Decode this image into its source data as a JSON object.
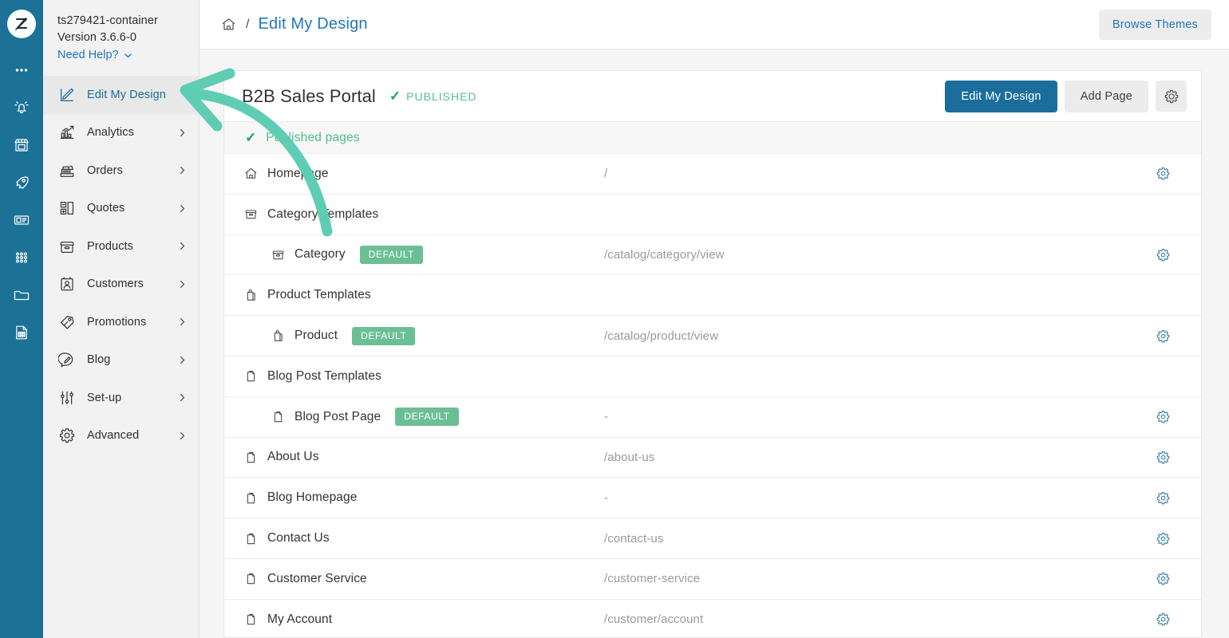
{
  "colors": {
    "rail_blue": "#1b7196",
    "accent_blue": "#2277b8",
    "primary_button": "#1b6e9c",
    "badge_green": "#6cbf94",
    "published_green": "#55bd8e",
    "check_green": "#1aa260",
    "annotation_arrow": "#5fcdb4",
    "panel_grey": "#f2f2f2"
  },
  "rail": {
    "logo_name": "zoey-logo-icon",
    "items": [
      {
        "name": "more-icon",
        "label": "More"
      },
      {
        "name": "notifications-bell-icon",
        "label": "Notifications"
      },
      {
        "name": "storefront-icon",
        "label": "Storefront"
      },
      {
        "name": "rocket-icon",
        "label": "Launch"
      },
      {
        "name": "news-card-icon",
        "label": "News"
      },
      {
        "name": "apps-grid-icon",
        "label": "Apps"
      },
      {
        "name": "folder-icon",
        "label": "Files"
      },
      {
        "name": "report-document-icon",
        "label": "Reports"
      }
    ]
  },
  "sidebar": {
    "store_name": "ts279421-container",
    "version": "Version 3.6.6-0",
    "need_help": "Need Help?",
    "items": [
      {
        "label": "Edit My Design",
        "icon": "design-pen-icon",
        "active": true,
        "chevron": false
      },
      {
        "label": "Analytics",
        "icon": "analytics-chart-icon",
        "active": false,
        "chevron": true
      },
      {
        "label": "Orders",
        "icon": "orders-register-icon",
        "active": false,
        "chevron": true
      },
      {
        "label": "Quotes",
        "icon": "quotes-blocks-icon",
        "active": false,
        "chevron": true
      },
      {
        "label": "Products",
        "icon": "products-box-icon",
        "active": false,
        "chevron": true
      },
      {
        "label": "Customers",
        "icon": "customers-badge-icon",
        "active": false,
        "chevron": true
      },
      {
        "label": "Promotions",
        "icon": "promotions-tag-icon",
        "active": false,
        "chevron": true
      },
      {
        "label": "Blog",
        "icon": "blog-comment-icon",
        "active": false,
        "chevron": true
      },
      {
        "label": "Set-up",
        "icon": "setup-sliders-icon",
        "active": false,
        "chevron": true
      },
      {
        "label": "Advanced",
        "icon": "advanced-gear-icon",
        "active": false,
        "chevron": true
      }
    ]
  },
  "topbar": {
    "home_icon": "home-icon",
    "separator": "/",
    "current": "Edit My Design",
    "browse_themes_label": "Browse Themes"
  },
  "card": {
    "title": "B2B Sales Portal",
    "status_check": "✓",
    "status_label": "PUBLISHED",
    "edit_design_label": "Edit My Design",
    "add_page_label": "Add Page",
    "settings_icon": "gear-icon"
  },
  "table": {
    "section_check": "✓",
    "section_label": "Published pages",
    "rows": [
      {
        "label": "Homepage",
        "icon": "home-icon",
        "indent": false,
        "badge": null,
        "url": "/",
        "gear": true
      },
      {
        "label": "Category Templates",
        "icon": "category-icon",
        "indent": false,
        "badge": null,
        "url": "",
        "gear": false
      },
      {
        "label": "Category",
        "icon": "category-icon",
        "indent": true,
        "badge": "DEFAULT",
        "url": "/catalog/category/view",
        "gear": true
      },
      {
        "label": "Product Templates",
        "icon": "product-icon",
        "indent": false,
        "badge": null,
        "url": "",
        "gear": false
      },
      {
        "label": "Product",
        "icon": "product-icon",
        "indent": true,
        "badge": "DEFAULT",
        "url": "/catalog/product/view",
        "gear": true
      },
      {
        "label": "Blog Post Templates",
        "icon": "page-icon",
        "indent": false,
        "badge": null,
        "url": "",
        "gear": false
      },
      {
        "label": "Blog Post Page",
        "icon": "page-icon",
        "indent": true,
        "badge": "DEFAULT",
        "url": "-",
        "gear": true
      },
      {
        "label": "About Us",
        "icon": "page-icon",
        "indent": false,
        "badge": null,
        "url": "/about-us",
        "gear": true
      },
      {
        "label": "Blog Homepage",
        "icon": "page-icon",
        "indent": false,
        "badge": null,
        "url": "-",
        "gear": true
      },
      {
        "label": "Contact Us",
        "icon": "page-icon",
        "indent": false,
        "badge": null,
        "url": "/contact-us",
        "gear": true
      },
      {
        "label": "Customer Service",
        "icon": "page-icon",
        "indent": false,
        "badge": null,
        "url": "/customer-service",
        "gear": true
      },
      {
        "label": "My Account",
        "icon": "page-icon",
        "indent": false,
        "badge": null,
        "url": "/customer/account",
        "gear": true
      }
    ]
  },
  "annotation": {
    "name": "arrow-pointing-to-edit-my-design",
    "color": "#5fcdb4"
  }
}
